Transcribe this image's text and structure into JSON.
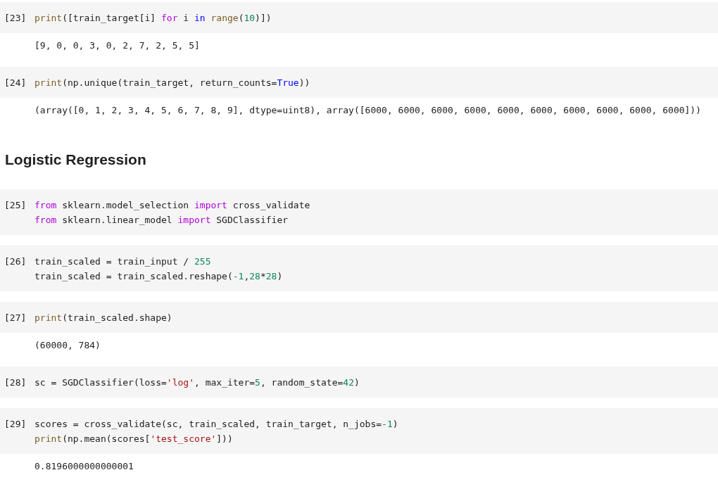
{
  "cells": [
    {
      "kind": "code",
      "prompt": "[23]",
      "lines": [
        [
          {
            "t": "print",
            "kind": "builtin"
          },
          {
            "t": "([train_target[i] ",
            "kind": "plain"
          },
          {
            "t": "for",
            "kind": "keyword"
          },
          {
            "t": " i ",
            "kind": "plain"
          },
          {
            "t": "in ",
            "kind": "operator"
          },
          {
            "t": "range",
            "kind": "builtin"
          },
          {
            "t": "(",
            "kind": "plain"
          },
          {
            "t": "10",
            "kind": "number"
          },
          {
            "t": ")])",
            "kind": "plain"
          }
        ]
      ],
      "output": "[9, 0, 0, 3, 0, 2, 7, 2, 5, 5]"
    },
    {
      "kind": "code",
      "prompt": "[24]",
      "lines": [
        [
          {
            "t": "print",
            "kind": "builtin"
          },
          {
            "t": "(np.unique(train_target, return_counts=",
            "kind": "plain"
          },
          {
            "t": "True",
            "kind": "constant"
          },
          {
            "t": "))",
            "kind": "plain"
          }
        ]
      ],
      "output": "(array([0, 1, 2, 3, 4, 5, 6, 7, 8, 9], dtype=uint8), array([6000, 6000, 6000, 6000, 6000, 6000, 6000, 6000, 6000, 6000]))"
    },
    {
      "kind": "heading",
      "text": "Logistic Regression"
    },
    {
      "kind": "code",
      "prompt": "[25]",
      "lines": [
        [
          {
            "t": "from",
            "kind": "keyword"
          },
          {
            "t": " sklearn.model_selection ",
            "kind": "plain"
          },
          {
            "t": "import",
            "kind": "keyword"
          },
          {
            "t": " cross_validate",
            "kind": "plain"
          }
        ],
        [
          {
            "t": "from",
            "kind": "keyword"
          },
          {
            "t": " sklearn.linear_model ",
            "kind": "plain"
          },
          {
            "t": "import",
            "kind": "keyword"
          },
          {
            "t": " SGDClassifier",
            "kind": "plain"
          }
        ]
      ]
    },
    {
      "kind": "code",
      "prompt": "[26]",
      "lines": [
        [
          {
            "t": "train_scaled = train_input / ",
            "kind": "plain"
          },
          {
            "t": "255",
            "kind": "number"
          }
        ],
        [
          {
            "t": "train_scaled = train_scaled.reshape(",
            "kind": "plain"
          },
          {
            "t": "-1",
            "kind": "number"
          },
          {
            "t": ",",
            "kind": "plain"
          },
          {
            "t": "28",
            "kind": "number"
          },
          {
            "t": "*",
            "kind": "plain"
          },
          {
            "t": "28",
            "kind": "number"
          },
          {
            "t": ")",
            "kind": "plain"
          }
        ]
      ]
    },
    {
      "kind": "code",
      "prompt": "[27]",
      "lines": [
        [
          {
            "t": "print",
            "kind": "builtin"
          },
          {
            "t": "(train_scaled.shape)",
            "kind": "plain"
          }
        ]
      ],
      "output": "(60000, 784)"
    },
    {
      "kind": "code",
      "prompt": "[28]",
      "lines": [
        [
          {
            "t": "sc = SGDClassifier(loss=",
            "kind": "plain"
          },
          {
            "t": "'log'",
            "kind": "string"
          },
          {
            "t": ", max_iter=",
            "kind": "plain"
          },
          {
            "t": "5",
            "kind": "number"
          },
          {
            "t": ", random_state=",
            "kind": "plain"
          },
          {
            "t": "42",
            "kind": "number"
          },
          {
            "t": ")",
            "kind": "plain"
          }
        ]
      ]
    },
    {
      "kind": "code",
      "prompt": "[29]",
      "lines": [
        [
          {
            "t": "scores = cross_validate(sc, train_scaled, train_target, n_jobs=",
            "kind": "plain"
          },
          {
            "t": "-1",
            "kind": "number"
          },
          {
            "t": ")",
            "kind": "plain"
          }
        ],
        [
          {
            "t": "print",
            "kind": "builtin"
          },
          {
            "t": "(np.mean(scores[",
            "kind": "plain"
          },
          {
            "t": "'test_score'",
            "kind": "string"
          },
          {
            "t": "]))",
            "kind": "plain"
          }
        ]
      ],
      "output": "0.8196000000000001"
    }
  ]
}
